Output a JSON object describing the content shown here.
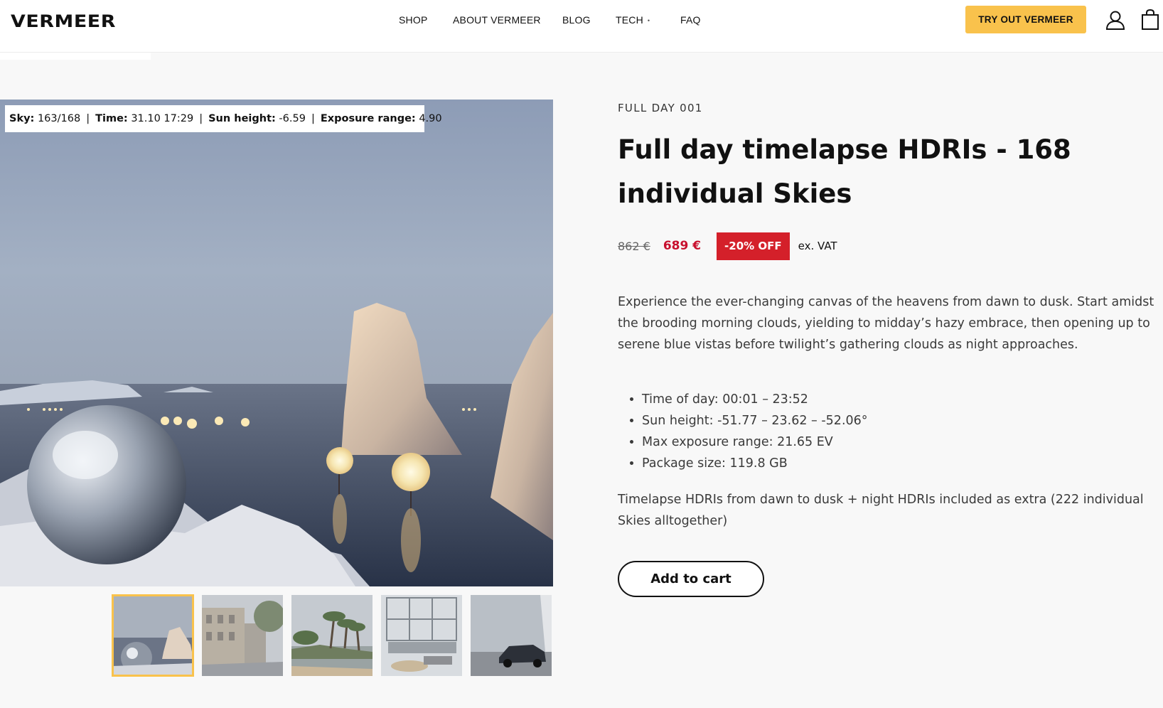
{
  "brand": {
    "logo": "VERMEER",
    "accent": "#f9c24c",
    "sale_red": "#d4202a"
  },
  "nav": {
    "items": [
      {
        "label": "SHOP"
      },
      {
        "label": "ABOUT VERMEER"
      },
      {
        "label": "BLOG"
      },
      {
        "label": "TECH",
        "has_dropdown": true
      },
      {
        "label": "FAQ"
      }
    ],
    "cta": "TRY OUT VERMEER",
    "icons": [
      "user-icon",
      "bag-icon"
    ]
  },
  "viewer": {
    "sky_label": "Sky:",
    "sky_value": "163/168",
    "time_label": "Time:",
    "time_value": "31.10 17:29",
    "sun_label": "Sun height:",
    "sun_value": "-6.59",
    "exposure_label": "Exposure range:",
    "exposure_value": "4.90",
    "separator": "|",
    "thumbnails": [
      {
        "name": "thumb-sky-spheres",
        "active": true
      },
      {
        "name": "thumb-street",
        "active": false
      },
      {
        "name": "thumb-palms-lake",
        "active": false
      },
      {
        "name": "thumb-interior",
        "active": false
      },
      {
        "name": "thumb-car",
        "active": false
      }
    ]
  },
  "product": {
    "eyebrow": "FULL DAY 001",
    "title": "Full day timelapse HDRIs - 168 individual Skies",
    "price_old": "862 €",
    "price_new": "689 €",
    "discount": "-20% OFF",
    "vat": "ex. VAT",
    "description": "Experience the ever-changing canvas of the heavens from dawn to dusk. Start amidst the brooding morning clouds, yielding to midday’s hazy embrace, then opening up to serene blue vistas before twilight’s gathering clouds as night approaches.",
    "specs": [
      "Time of day: 00:01 – 23:52",
      "Sun height: -51.77 – 23.62 – -52.06°",
      "Max exposure range: 21.65 EV",
      "Package size: 119.8 GB"
    ],
    "note": "Timelapse HDRIs from dawn to dusk + night HDRIs included as extra (222 individual Skies alltogether)",
    "add_to_cart": "Add to cart"
  }
}
